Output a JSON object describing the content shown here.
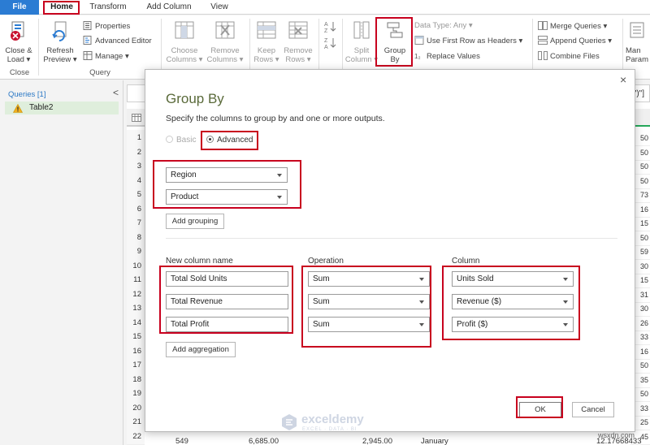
{
  "tabs": {
    "file": "File",
    "home": "Home",
    "transform": "Transform",
    "add_column": "Add Column",
    "view": "View"
  },
  "ribbon": {
    "close_load": [
      "Close &",
      "Load ▾"
    ],
    "close_group": "Close",
    "refresh": [
      "Refresh",
      "Preview ▾"
    ],
    "properties": "Properties",
    "advanced_editor": "Advanced Editor",
    "manage": "Manage ▾",
    "query_group": "Query",
    "choose_columns": [
      "Choose",
      "Columns ▾"
    ],
    "remove_columns": [
      "Remove",
      "Columns ▾"
    ],
    "keep_rows": [
      "Keep",
      "Rows ▾"
    ],
    "remove_rows": [
      "Remove",
      "Rows ▾"
    ],
    "split_column": [
      "Split",
      "Column ▾"
    ],
    "group_by": [
      "Group",
      "By"
    ],
    "data_type": "Data Type: Any ▾",
    "first_row_headers": "Use First Row as Headers ▾",
    "replace_values": "Replace Values",
    "merge_queries": "Merge Queries ▾",
    "append_queries": "Append Queries ▾",
    "combine_files": "Combine Files",
    "manage_params": [
      "Man",
      "Param"
    ]
  },
  "queries": {
    "header": "Queries [1]",
    "collapse": "<",
    "item": "Table2"
  },
  "grid": {
    "formula_tail": "\")\"]",
    "row_numbers": [
      "1",
      "2",
      "3",
      "4",
      "5",
      "6",
      "7",
      "8",
      "9",
      "10",
      "11",
      "12",
      "13",
      "14",
      "15",
      "16",
      "17",
      "18",
      "19",
      "20",
      "21",
      "22"
    ],
    "right_values": [
      "50",
      "50",
      "50",
      "50",
      "73",
      "16",
      "15",
      "50",
      "59",
      "30",
      "15",
      "31",
      "30",
      "26",
      "33",
      "16",
      "50",
      "35",
      "50",
      "33",
      "25",
      "45"
    ],
    "bottom_row": [
      "549",
      "6,685.00",
      "2,945.00",
      "January",
      "12.17668433"
    ]
  },
  "dialog": {
    "title": "Group By",
    "subtitle": "Specify the columns to group by and one or more outputs.",
    "close": "×",
    "basic": "Basic",
    "advanced": "Advanced",
    "grouping": [
      "Region",
      "Product"
    ],
    "add_grouping": "Add grouping",
    "col_new_name": "New column name",
    "col_operation": "Operation",
    "col_column": "Column",
    "aggregations": [
      {
        "name": "Total Sold Units",
        "operation": "Sum",
        "column": "Units Sold"
      },
      {
        "name": "Total Revenue",
        "operation": "Sum",
        "column": "Revenue ($)"
      },
      {
        "name": "Total Profit",
        "operation": "Sum",
        "column": "Profit ($)"
      }
    ],
    "add_aggregation": "Add aggregation",
    "ok": "OK",
    "cancel": "Cancel"
  },
  "watermark": {
    "name": "exceldemy",
    "tagline": "EXCEL · DATA · BI"
  },
  "site": "wsxdn.com",
  "colors": {
    "highlight": "#c8001e",
    "file_tab": "#2b7cd3",
    "accent_green": "#25a85a",
    "query_selected": "#dfeedc"
  }
}
